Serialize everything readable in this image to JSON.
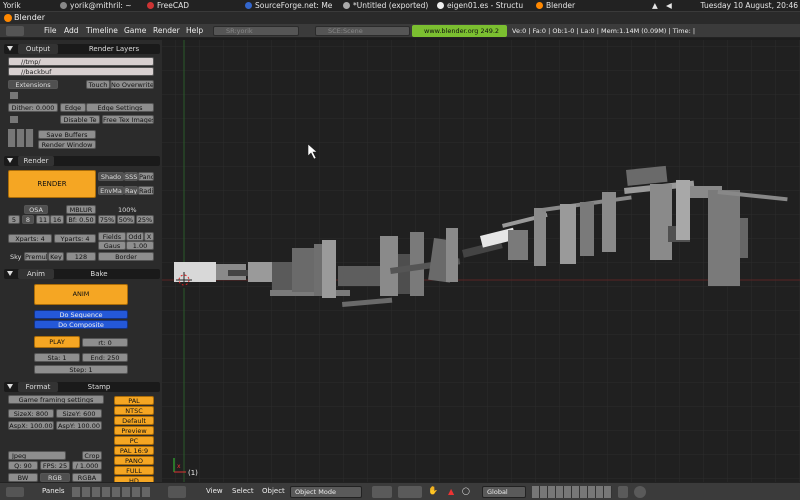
{
  "taskbar": {
    "user": "Yorik",
    "items": [
      "yorik@mithril: ~",
      "FreeCAD",
      "SourceForge.net: Me",
      "*Untitled (exported)",
      "eigen01.es - Structu",
      "Blender"
    ],
    "clock": "Tuesday 10 August, 20:46"
  },
  "window": {
    "title": "Blender"
  },
  "menubar": {
    "menus": [
      "File",
      "Add",
      "Timeline",
      "Game",
      "Render",
      "Help"
    ],
    "screen": "SR:yorik",
    "scene": "SCE:Scene",
    "url": "www.blender.org 249.2",
    "stats": "Ve:0 | Fa:0 | Ob:1-0 | La:0 | Mem:1.14M (0.09M) | Time: |"
  },
  "output_panel": {
    "tabs": [
      "Output",
      "Render Layers"
    ],
    "paths": [
      "//tmp/",
      "//backbuf"
    ],
    "extensions": "Extensions",
    "touch": "Touch",
    "no_overwrite": "No Overwrite",
    "dither": "Dither: 0.000",
    "edge": "Edge",
    "edge_settings": "Edge Settings",
    "disable_tex": "Disable Te",
    "free_tex": "Free Tex Images",
    "save_buffers": "Save Buffers",
    "render_window": "Render Window"
  },
  "render_panel": {
    "title": "Render",
    "render_btn": "RENDER",
    "shadow": "Shado",
    "sss": "SSS",
    "pano": "Pano",
    "envmap": "EnvMa",
    "ray": "Ray",
    "radio": "Radi",
    "osa": "OSA",
    "mblur": "MBLUR",
    "percent": "100%",
    "osa_vals": [
      "5",
      "8",
      "11",
      "16"
    ],
    "bf": "Bf: 0.50",
    "pcts": [
      "75%",
      "50%",
      "25%"
    ],
    "xparts": "Xparts: 4",
    "yparts": "Yparts: 4",
    "fields": "Fields",
    "odd": "Odd",
    "x": "X",
    "gauss": "Gaus",
    "gauss_val": "1.00",
    "sky": "Sky",
    "premul": "Premul",
    "key": "Key",
    "key_val": "128",
    "border": "Border"
  },
  "anim_panel": {
    "tabs": [
      "Anim",
      "Bake"
    ],
    "anim": "ANIM",
    "do_sequence": "Do Sequence",
    "do_composite": "Do Composite",
    "play": "PLAY",
    "rt": "rt: 0",
    "sta": "Sta: 1",
    "end": "End: 250",
    "step": "Step: 1"
  },
  "format_panel": {
    "tabs": [
      "Format",
      "Stamp"
    ],
    "game_framing": "Game framing settings",
    "sizex": "SizeX: 800",
    "sizey": "SizeY: 600",
    "aspx": "AspX: 100.00",
    "aspy": "AspY: 100.00",
    "presets": [
      "PAL",
      "NTSC",
      "Default",
      "Preview",
      "PC",
      "PAL 16:9",
      "PANO",
      "FULL",
      "HD"
    ],
    "format": "Jpeg",
    "crop": "Crop",
    "quality": "Q: 90",
    "fps": "FPS: 25",
    "fps_base": "/ 1.000",
    "bw": "BW",
    "rgb": "RGB",
    "rgba": "RGBA"
  },
  "left_bottom": {
    "panels": "Panels"
  },
  "viewport": {
    "frame_label": "(1)"
  },
  "bottombar": {
    "view": "View",
    "select": "Select",
    "object": "Object",
    "mode": "Object Mode",
    "orientation": "Global"
  },
  "colors": {
    "accent_orange": "#f5a623",
    "button_blue": "#2458d8",
    "grid": "#2a2a2a",
    "x_axis": "#6a2a2a",
    "y_axis": "#2a6a2a"
  }
}
